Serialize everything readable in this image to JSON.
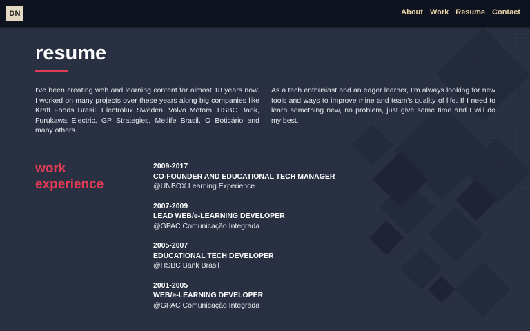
{
  "header": {
    "logo_text": "DN",
    "nav": [
      {
        "label": "About"
      },
      {
        "label": "Work"
      },
      {
        "label": "Resume"
      },
      {
        "label": "Contact"
      }
    ]
  },
  "resume": {
    "title": "resume",
    "intro_left": "I've been creating web and learning content for almost 18 years now. I worked on many projects over these years along big companies like Kraft Foods Brasil, Electrolux Sweden, Volvo Motors, HSBC Bank, Furukawa Electric, GP Strategies, Metlife Brasil, O Boticário and many others.",
    "intro_right": "As a tech enthusiast and an eager learner, I'm always looking for new tools and ways to improve mine and team's quality of life. If I need to learn something new, no problem, just give some time and I will do my best."
  },
  "work_experience": {
    "title_line1": "work",
    "title_line2": "experience",
    "jobs": [
      {
        "period": "2009-2017",
        "role": "CO-FOUNDER AND EDUCATIONAL TECH MANAGER",
        "company": "@UNBOX Learning Experience"
      },
      {
        "period": "2007-2009",
        "role": "LEAD WEB/e-LEARNING DEVELOPER",
        "company": "@GPAC Comunicação Integrada"
      },
      {
        "period": "2005-2007",
        "role": "EDUCATIONAL TECH DEVELOPER",
        "company": "@HSBC Bank Brasil"
      },
      {
        "period": "2001-2005",
        "role": "WEB/e-LEARNING DEVELOPER",
        "company": "@GPAC Comunicação Integrada"
      }
    ]
  },
  "colors": {
    "background": "#283041",
    "topbar": "#0f1320",
    "accent": "#e13b55",
    "nav_text": "#e6d3a8",
    "logo_bg": "#e3d9c2"
  }
}
